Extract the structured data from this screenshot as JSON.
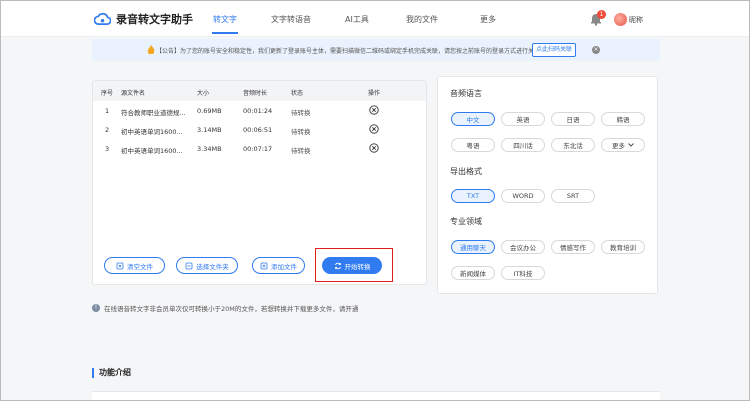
{
  "header": {
    "logo_text": "录音转文字助手",
    "nav": [
      "转文字",
      "文字转语音",
      "AI工具",
      "我的文件",
      "更多"
    ],
    "bell_badge": "1",
    "username": "昵称"
  },
  "notice": {
    "text": "【公告】为了您的账号安全和稳定性，我们更新了登录账号主体，需要扫描微信二维码或绑定手机完成关联，请您按之前账号的登录方式进行关联。",
    "button": "点此扫码关联",
    "close": "×"
  },
  "table": {
    "headers": [
      "序号",
      "源文件名",
      "大小",
      "音频时长",
      "状态",
      "操作"
    ],
    "rows": [
      {
        "no": "1",
        "name": "符合教师职业道德规...",
        "size": "0.69MB",
        "duration": "00:01:24",
        "status": "待转换"
      },
      {
        "no": "2",
        "name": "初中英语单词1600...",
        "size": "3.14MB",
        "duration": "00:06:51",
        "status": "待转换"
      },
      {
        "no": "3",
        "name": "初中英语单词1600...",
        "size": "3.34MB",
        "duration": "00:07:17",
        "status": "待转换"
      }
    ]
  },
  "actions": {
    "clear": "清空文件",
    "select_folder": "选择文件夹",
    "add_file": "添加文件",
    "start": "开始转换"
  },
  "hint": "在线语音转文字非会员单次仅可转换小于20M的文件，若想转换并下载更多文件，请开通",
  "settings": {
    "audio_lang_title": "音频语言",
    "audio_langs": [
      "中文",
      "英语",
      "日语",
      "韩语",
      "粤语",
      "四川话",
      "东北话",
      "更多"
    ],
    "export_title": "导出格式",
    "formats": [
      "TXT",
      "WORD",
      "SRT"
    ],
    "domain_title": "专业领域",
    "domains": [
      "通用聊天",
      "会议办公",
      "情感写作",
      "教育培训",
      "新闻媒体",
      "IT科技"
    ]
  },
  "intro_title": "功能介绍",
  "colors": {
    "accent": "#2f7bef",
    "danger": "#e02020"
  }
}
